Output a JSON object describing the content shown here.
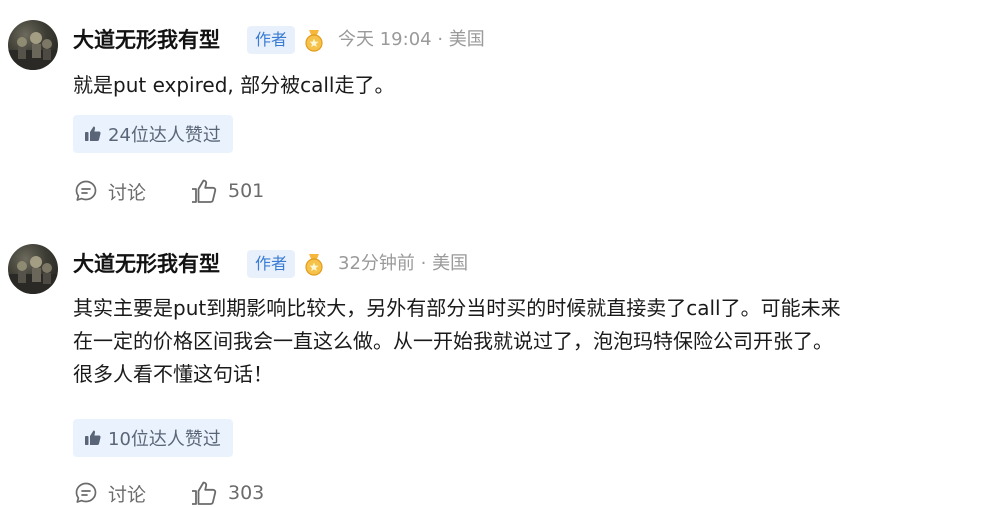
{
  "comments": [
    {
      "username": "大道无形我有型",
      "author_tag": "作者",
      "meta": "今天 19:04 · 美国",
      "text": "就是put expired, 部分被call走了。",
      "likes_chip": "24位达人赞过",
      "discuss_label": "讨论",
      "like_count": "501"
    },
    {
      "username": "大道无形我有型",
      "author_tag": "作者",
      "meta": "32分钟前 · 美国",
      "text": "其实主要是put到期影响比较大，另外有部分当时买的时候就直接卖了call了。可能未来\n在一定的价格区间我会一直这么做。从一开始我就说过了，泡泡玛特保险公司开张了。\n很多人看不懂这句话！",
      "likes_chip": "10位达人赞过",
      "discuss_label": "讨论",
      "like_count": "303"
    }
  ],
  "colors": {
    "author_tag_bg": "#e8f1fb",
    "author_tag_text": "#3a7bd5",
    "chip_bg": "#eaf3fd",
    "meta_text": "#9a9a9a"
  },
  "icons": {
    "medal": "gold-medal-icon",
    "chip_thumb": "thumbs-up-filled-icon",
    "discuss": "chat-bubble-icon",
    "like": "thumbs-up-outline-icon"
  }
}
